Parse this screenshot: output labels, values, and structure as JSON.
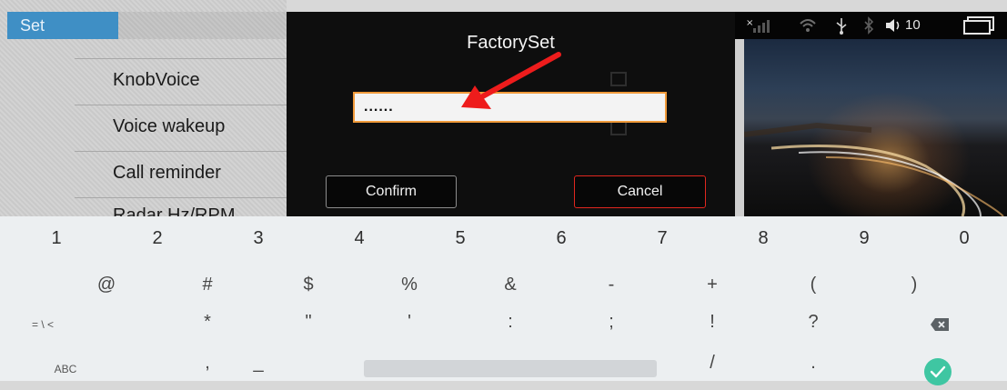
{
  "settings": {
    "tab_label": "Set",
    "items": [
      "KnobVoice",
      "Voice wakeup",
      "Call reminder",
      "Radar Hz/RPM"
    ]
  },
  "dialog": {
    "title": "FactorySet",
    "password_value": "......",
    "confirm_label": "Confirm",
    "cancel_label": "Cancel",
    "accent_color": "#f09a3a",
    "cancel_border_color": "#e0271f"
  },
  "statusbar": {
    "battery_level": "10",
    "icons": [
      "signal-off-icon",
      "wifi-icon",
      "usb-icon",
      "bluetooth-icon",
      "volume-icon",
      "recent-apps-icon"
    ]
  },
  "annotation": {
    "arrow_color": "#ee1c1c"
  },
  "keyboard": {
    "row1": [
      "1",
      "2",
      "3",
      "4",
      "5",
      "6",
      "7",
      "8",
      "9",
      "0"
    ],
    "row2": [
      "@",
      "#",
      "$",
      "%",
      "&",
      "-",
      "+",
      "(",
      ")"
    ],
    "row3": [
      "= \\ <",
      "*",
      "\"",
      "'",
      ":",
      ";",
      "!",
      "?"
    ],
    "row4": [
      "ABC",
      ",",
      "_",
      "/",
      "."
    ],
    "enter_color": "#3fc6a2"
  }
}
